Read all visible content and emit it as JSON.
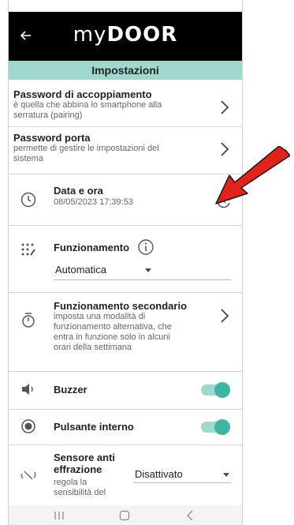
{
  "header": {
    "brand_thin": "my",
    "brand_bold": "DOOR",
    "section_title": "Impostazioni"
  },
  "settings": {
    "pairing_title": "Password di accoppiamento",
    "pairing_desc": "è quella che abbina lo smartphone alla serratura (pairing)",
    "door_title": "Password porta",
    "door_desc": "permette di gestire le impostazioni del sistema",
    "datetime_title": "Data e ora",
    "datetime_value": "08/05/2023 17:39:53",
    "mode_title": "Funzionamento",
    "mode_value": "Automatica",
    "secondary_title": "Funzionamento secondario",
    "secondary_desc": "imposta una modalità di funzionamento alternativa, che entra in funzione solo in alcuni orari della settimana",
    "buzzer_title": "Buzzer",
    "buzzer_on": true,
    "inner_button_title": "Pulsante interno",
    "inner_button_on": true,
    "tamper_title": "Sensore anti effrazione",
    "tamper_desc": "regola la sensibilità del",
    "tamper_value": "Disattivato"
  },
  "colors": {
    "accent": "#9fd9cd",
    "toggle_knob": "#3db5a3",
    "annotation_arrow": "#e2231a"
  },
  "icons": [
    "back-arrow-icon",
    "chevron-right-icon",
    "clock-icon",
    "refresh-clock-icon",
    "grid-settings-icon",
    "info-icon",
    "dropdown-caret-icon",
    "stopwatch-icon",
    "speaker-icon",
    "radio-button-icon",
    "vibration-sensor-icon",
    "recents-icon",
    "home-icon",
    "back-nav-icon"
  ]
}
